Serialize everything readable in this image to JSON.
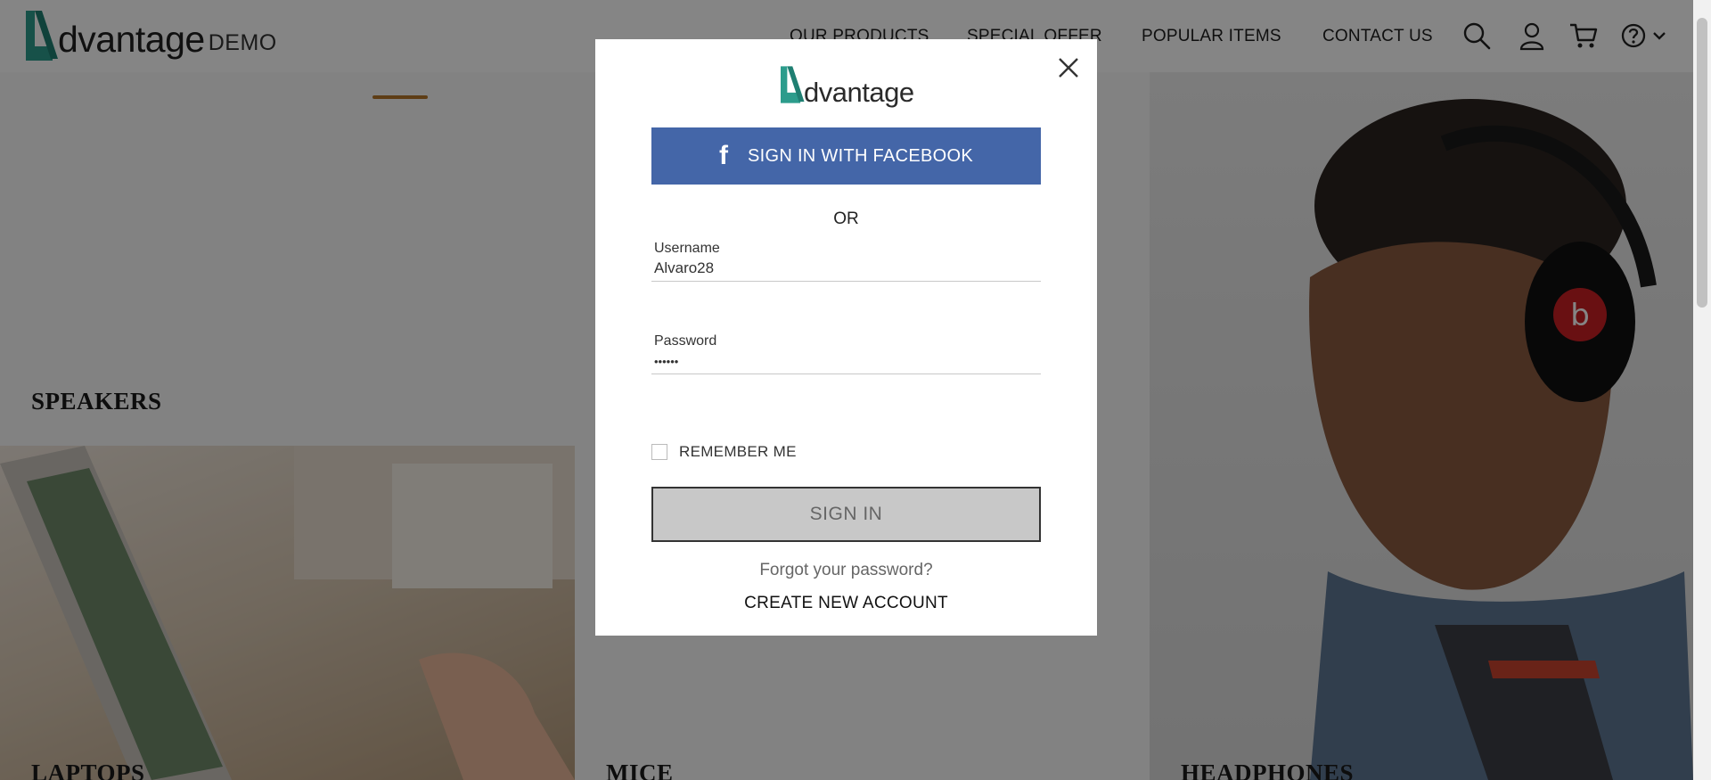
{
  "header": {
    "logo_text": "dvantage",
    "logo_suffix": "DEMO",
    "nav": [
      {
        "label": "OUR PRODUCTS"
      },
      {
        "label": "SPECIAL OFFER"
      },
      {
        "label": "POPULAR ITEMS"
      },
      {
        "label": "CONTACT US"
      }
    ],
    "icons": [
      "search-icon",
      "user-icon",
      "cart-icon",
      "help-icon",
      "chevron-down-icon"
    ]
  },
  "categories": [
    {
      "label": "SPEAKERS"
    },
    {
      "label": "LAPTOPS"
    },
    {
      "label": "MICE"
    },
    {
      "label": "HEADPHONES"
    }
  ],
  "login_modal": {
    "logo_text": "dvantage",
    "facebook_icon": "f",
    "facebook_label": "SIGN IN WITH FACEBOOK",
    "or_label": "OR",
    "username_label": "Username",
    "username_value": "Alvaro28",
    "password_label": "Password",
    "password_value": "••••••",
    "remember_label": "REMEMBER ME",
    "signin_label": "SIGN IN",
    "forgot_label": "Forgot your password?",
    "create_label": "CREATE NEW ACCOUNT"
  },
  "colors": {
    "brand_teal": "#2c9c8c",
    "facebook_blue": "#4466a8",
    "overlay": "rgba(0,0,0,0.48)"
  }
}
